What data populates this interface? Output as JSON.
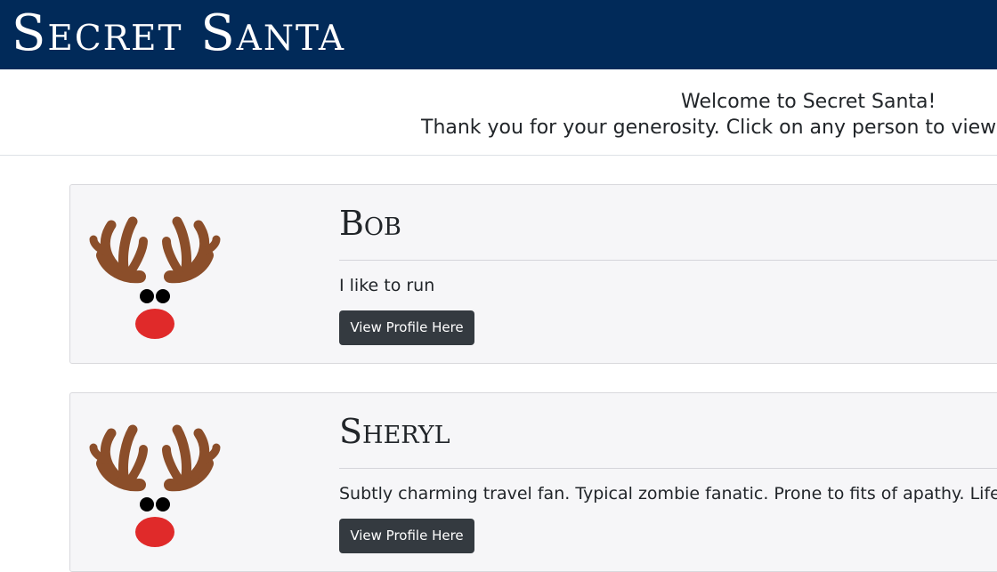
{
  "header": {
    "brand": "Secret Santa",
    "color": "#012a59"
  },
  "welcome": {
    "title": "Welcome to Secret Santa!",
    "subtitle": "Thank you for your generosity. Click on any person to view"
  },
  "people": [
    {
      "name": "Bob",
      "description": "I like to run",
      "button_label": "View Profile Here",
      "avatar_icon": "reindeer-icon"
    },
    {
      "name": "Sheryl",
      "description": "Subtly charming travel fan. Typical zombie fanatic. Prone to fits of apathy. Lifelong",
      "button_label": "View Profile Here",
      "avatar_icon": "reindeer-icon"
    }
  ]
}
